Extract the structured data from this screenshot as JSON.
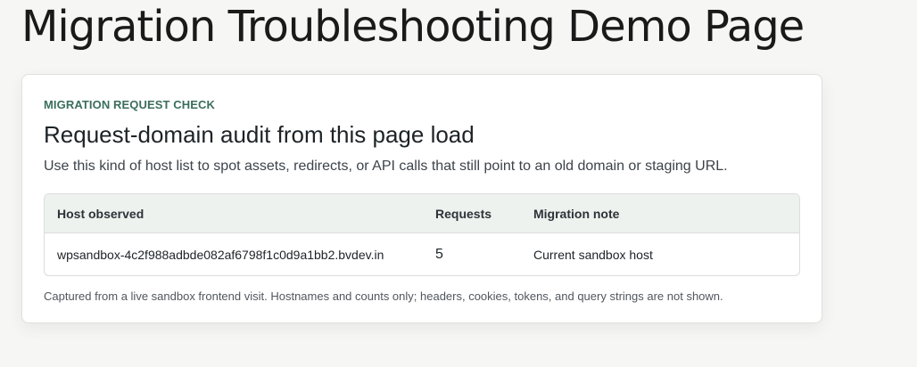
{
  "page": {
    "title": "Migration Troubleshooting Demo Page"
  },
  "card": {
    "eyebrow": "MIGRATION REQUEST CHECK",
    "heading": "Request-domain audit from this page load",
    "description": "Use this kind of host list to spot assets, redirects, or API calls that still point to an old domain or staging URL.",
    "table": {
      "headers": {
        "host": "Host observed",
        "requests": "Requests",
        "note": "Migration note"
      },
      "rows": [
        {
          "host": "wpsandbox-4c2f988adbde082af6798f1c0d9a1bb2.bvdev.in",
          "requests": "5",
          "note": "Current sandbox host"
        }
      ]
    },
    "footnote": "Captured from a live sandbox frontend visit. Hostnames and counts only; headers, cookies, tokens, and query strings are not shown."
  },
  "colors": {
    "background": "#f6f6f4",
    "accent": "#3b6e5c",
    "table_header_bg": "#eef2ef"
  }
}
